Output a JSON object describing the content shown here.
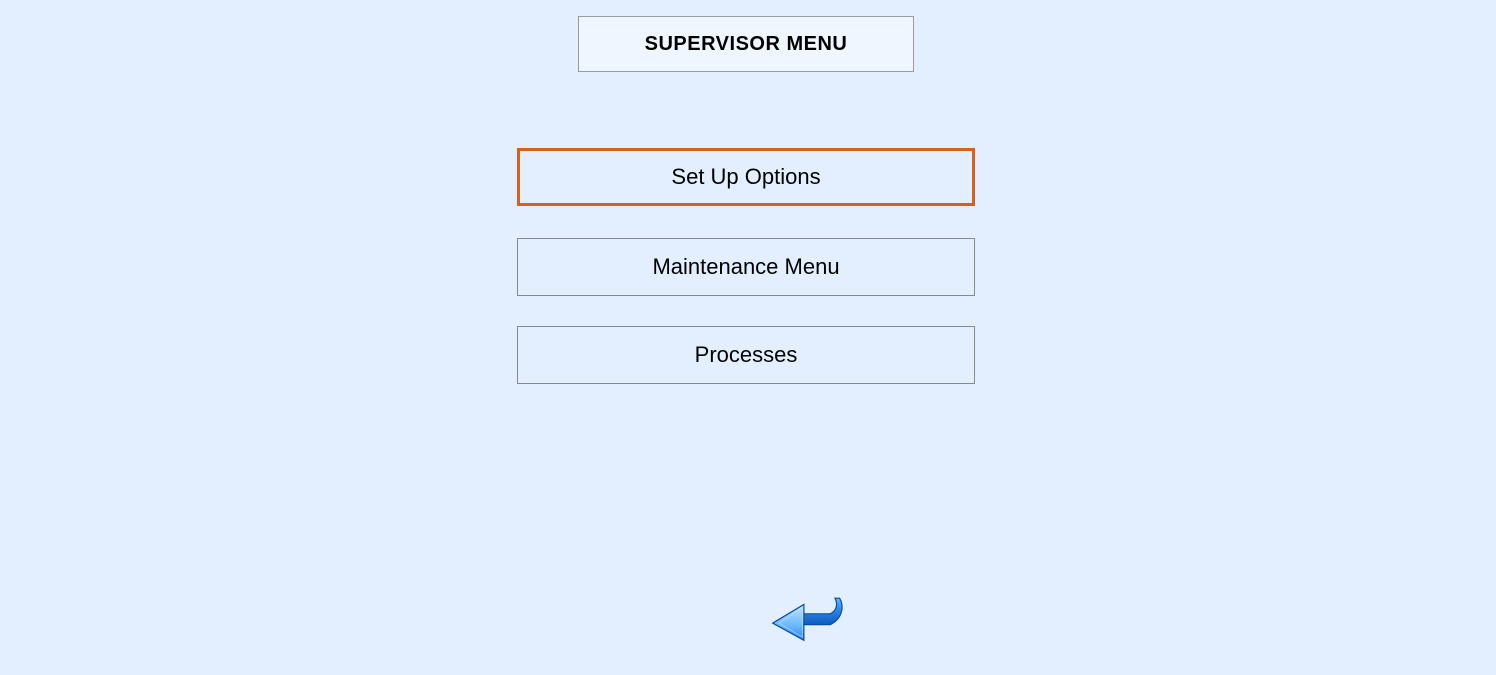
{
  "title": "SUPERVISOR MENU",
  "menu": {
    "setup": "Set Up Options",
    "maintenance": "Maintenance Menu",
    "processes": "Processes"
  }
}
